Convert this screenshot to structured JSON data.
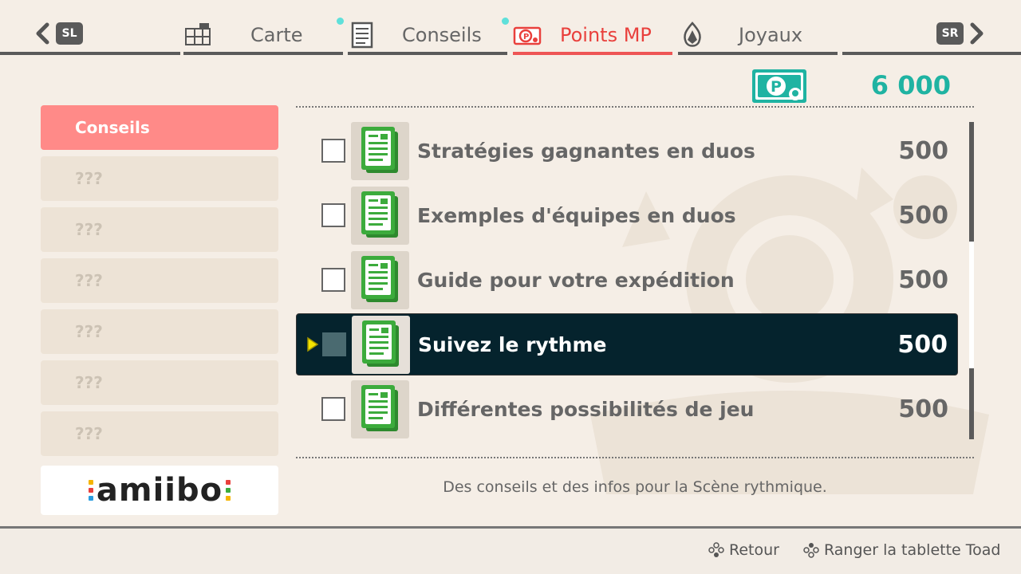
{
  "tabs": {
    "left_shoulder": "SL",
    "right_shoulder": "SR",
    "items": [
      {
        "label": "Carte",
        "icon": "map-icon",
        "active": false
      },
      {
        "label": "Conseils",
        "icon": "notepad-icon",
        "active": false,
        "new": true
      },
      {
        "label": "Points MP",
        "icon": "mp-points-icon",
        "active": true,
        "new": true
      },
      {
        "label": "Joyaux",
        "icon": "gem-icon",
        "active": false
      }
    ]
  },
  "sidebar": {
    "items": [
      {
        "label": "Conseils",
        "active": true
      },
      {
        "label": "???"
      },
      {
        "label": "???"
      },
      {
        "label": "???"
      },
      {
        "label": "???"
      },
      {
        "label": "???"
      },
      {
        "label": "???"
      }
    ],
    "amiibo_label": "amiibo"
  },
  "points": {
    "value": "6 000"
  },
  "list": {
    "items": [
      {
        "title": "Stratégies gagnantes en duos",
        "price": "500",
        "selected": false
      },
      {
        "title": "Exemples d'équipes en duos",
        "price": "500",
        "selected": false
      },
      {
        "title": "Guide pour votre expédition",
        "price": "500",
        "selected": false
      },
      {
        "title": "Suivez le rythme",
        "price": "500",
        "selected": true
      },
      {
        "title": "Différentes possibilités de jeu",
        "price": "500",
        "selected": false
      }
    ]
  },
  "description": "Des conseils et des infos pour la Scène rythmique.",
  "footer": {
    "back_label": "Retour",
    "close_label": "Ranger la tablette Toad"
  },
  "colors": {
    "accent_red": "#e9403c",
    "points_teal": "#1fb3a2",
    "selected_row": "#05232d",
    "sidebar_active": "#ff8a88",
    "doc_green": "#3cab3c"
  }
}
